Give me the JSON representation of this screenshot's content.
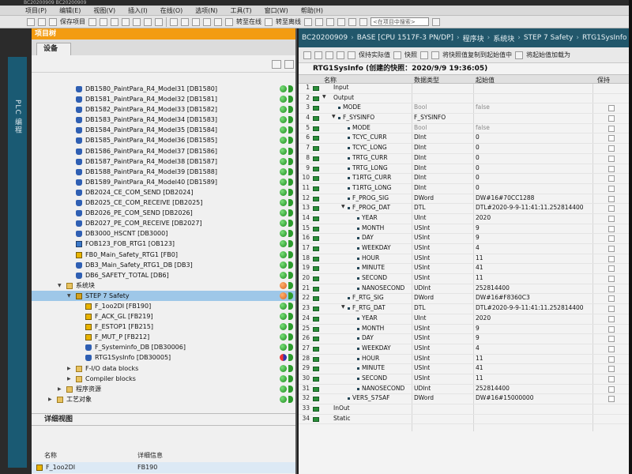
{
  "window": {
    "title": "BC20200909 BC20200909"
  },
  "menu": [
    "项目(P)",
    "编辑(E)",
    "视图(V)",
    "插入(I)",
    "在线(O)",
    "选项(N)",
    "工具(T)",
    "窗口(W)",
    "帮助(H)"
  ],
  "toolbar": {
    "save_project": "保存项目",
    "go_online": "转至在线",
    "go_offline": "转至离线",
    "search_placeholder": "<在项目中搜索>"
  },
  "vertical_tab": "PLC 编程",
  "project_tree": {
    "header": "项目树",
    "device_tab": "设备",
    "items": [
      {
        "label": "DB1580_PaintPara_R4_Model31 [DB1580]",
        "icon": "db-icon",
        "indent": 1,
        "status": "green"
      },
      {
        "label": "DB1581_PaintPara_R4_Model32 [DB1581]",
        "icon": "db-icon",
        "indent": 1,
        "status": "green"
      },
      {
        "label": "DB1582_PaintPara_R4_Model33 [DB1582]",
        "icon": "db-icon",
        "indent": 1,
        "status": "green"
      },
      {
        "label": "DB1583_PaintPara_R4_Model34 [DB1583]",
        "icon": "db-icon",
        "indent": 1,
        "status": "green"
      },
      {
        "label": "DB1584_PaintPara_R4_Model35 [DB1584]",
        "icon": "db-icon",
        "indent": 1,
        "status": "green"
      },
      {
        "label": "DB1585_PaintPara_R4_Model36 [DB1585]",
        "icon": "db-icon",
        "indent": 1,
        "status": "green"
      },
      {
        "label": "DB1586_PaintPara_R4_Model37 [DB1586]",
        "icon": "db-icon",
        "indent": 1,
        "status": "green"
      },
      {
        "label": "DB1587_PaintPara_R4_Model38 [DB1587]",
        "icon": "db-icon",
        "indent": 1,
        "status": "green"
      },
      {
        "label": "DB1588_PaintPara_R4_Model39 [DB1588]",
        "icon": "db-icon",
        "indent": 1,
        "status": "green"
      },
      {
        "label": "DB1589_PaintPara_R4_Model40 [DB1589]",
        "icon": "db-icon",
        "indent": 1,
        "status": "green"
      },
      {
        "label": "DB2024_CE_COM_SEND [DB2024]",
        "icon": "db-icon",
        "indent": 1,
        "status": "green"
      },
      {
        "label": "DB2025_CE_COM_RECEIVE [DB2025]",
        "icon": "db-icon",
        "indent": 1,
        "status": "green"
      },
      {
        "label": "DB2026_PE_COM_SEND [DB2026]",
        "icon": "db-icon",
        "indent": 1,
        "status": "green"
      },
      {
        "label": "DB2027_PE_COM_RECEIVE [DB2027]",
        "icon": "db-icon",
        "indent": 1,
        "status": "green"
      },
      {
        "label": "DB3000_HSCNT [DB3000]",
        "icon": "db-icon",
        "indent": 1,
        "status": "green"
      },
      {
        "label": "FOB123_FOB_RTG1 [OB123]",
        "icon": "ob-icon",
        "indent": 1,
        "status": "green"
      },
      {
        "label": "FB0_Main_Safety_RTG1 [FB0]",
        "icon": "fb-icon",
        "indent": 1,
        "status": "green"
      },
      {
        "label": "DB3_Main_Safety_RTG1_DB [DB3]",
        "icon": "db-icon",
        "indent": 1,
        "status": "green"
      },
      {
        "label": "DB6_SAFETY_TOTAL [DB6]",
        "icon": "db-icon",
        "indent": 1,
        "status": "green"
      },
      {
        "label": "系统块",
        "icon": "folder-icon",
        "indent": 0,
        "status": "orange",
        "expander": "▼"
      },
      {
        "label": "STEP 7 Safety",
        "icon": "safety-folder-icon",
        "indent": 1,
        "status": "orange",
        "expander": "▼",
        "selected": true
      },
      {
        "label": "F_1oo2DI [FB190]",
        "icon": "fb-icon",
        "indent": 2,
        "status": "green"
      },
      {
        "label": "F_ACK_GL [FB219]",
        "icon": "fb-icon",
        "indent": 2,
        "status": "green"
      },
      {
        "label": "F_ESTOP1 [FB215]",
        "icon": "fb-icon",
        "indent": 2,
        "status": "green"
      },
      {
        "label": "F_MUT_P [FB212]",
        "icon": "fb-icon",
        "indent": 2,
        "status": "green"
      },
      {
        "label": "F_Systeminfo_DB [DB30006]",
        "icon": "db-icon",
        "indent": 2,
        "status": "green"
      },
      {
        "label": "RTG1SysInfo [DB30005]",
        "icon": "db-icon",
        "indent": 2,
        "status": "split"
      },
      {
        "label": "F-I/O data blocks",
        "icon": "folder-icon",
        "indent": 1,
        "status": "green",
        "expander": "▶"
      },
      {
        "label": "Compiler blocks",
        "icon": "folder-icon",
        "indent": 1,
        "status": "green",
        "expander": "▶"
      },
      {
        "label": "程序资源",
        "icon": "folder-icon",
        "indent": 0,
        "status": "green",
        "expander": "▶"
      },
      {
        "label": "工艺对象",
        "icon": "folder-icon",
        "indent": -1,
        "status": "green",
        "expander": "▶"
      }
    ]
  },
  "detail_view": {
    "header": "详细视图",
    "col_name": "名称",
    "col_info": "详细信息",
    "row_name": "F_1oo2DI",
    "row_info": "FB190"
  },
  "editor": {
    "breadcrumb": [
      "BC20200909",
      "BASE [CPU 1517F-3 PN/DP]",
      "程序块",
      "系统块",
      "STEP 7 Safety",
      "RTG1SysInfo [DB30005]"
    ],
    "toolbar": {
      "keep_actual": "保持实际值",
      "snapshot": "快照",
      "copy_snapshot": "将快照值复制到起始值中",
      "load_start": "将起始值加载为"
    },
    "block_title": "RTG1SysInfo (创建的快照：2020/9/9 19:36:05)",
    "columns": {
      "name": "名称",
      "dtype": "数据类型",
      "start": "起始值",
      "retain": "保持"
    },
    "rows": [
      {
        "n": "1",
        "name": "Input",
        "level": 0,
        "arrow": "",
        "dtype": "",
        "start": ""
      },
      {
        "n": "2",
        "name": "Output",
        "level": 0,
        "arrow": "▼",
        "dtype": "",
        "start": ""
      },
      {
        "n": "3",
        "name": "MODE",
        "level": 1,
        "arrow": "",
        "dtype": "Bool",
        "start": "false",
        "muted": true
      },
      {
        "n": "4",
        "name": "F_SYSINFO",
        "level": 1,
        "arrow": "▼",
        "dtype": "F_SYSINFO",
        "start": ""
      },
      {
        "n": "5",
        "name": "MODE",
        "level": 2,
        "arrow": "",
        "dtype": "Bool",
        "start": "false",
        "muted": true
      },
      {
        "n": "6",
        "name": "TCYC_CURR",
        "level": 2,
        "arrow": "",
        "dtype": "DInt",
        "start": "0"
      },
      {
        "n": "7",
        "name": "TCYC_LONG",
        "level": 2,
        "arrow": "",
        "dtype": "DInt",
        "start": "0"
      },
      {
        "n": "8",
        "name": "TRTG_CURR",
        "level": 2,
        "arrow": "",
        "dtype": "DInt",
        "start": "0"
      },
      {
        "n": "9",
        "name": "TRTG_LONG",
        "level": 2,
        "arrow": "",
        "dtype": "DInt",
        "start": "0"
      },
      {
        "n": "10",
        "name": "T1RTG_CURR",
        "level": 2,
        "arrow": "",
        "dtype": "DInt",
        "start": "0"
      },
      {
        "n": "11",
        "name": "T1RTG_LONG",
        "level": 2,
        "arrow": "",
        "dtype": "DInt",
        "start": "0"
      },
      {
        "n": "12",
        "name": "F_PROG_SIG",
        "level": 2,
        "arrow": "",
        "dtype": "DWord",
        "start": "DW#16#70CC1288"
      },
      {
        "n": "13",
        "name": "F_PROG_DAT",
        "level": 2,
        "arrow": "▼",
        "dtype": "DTL",
        "start": "DTL#2020-9-9-11:41:11.252814400"
      },
      {
        "n": "14",
        "name": "YEAR",
        "level": 3,
        "arrow": "",
        "dtype": "UInt",
        "start": "2020"
      },
      {
        "n": "15",
        "name": "MONTH",
        "level": 3,
        "arrow": "",
        "dtype": "USInt",
        "start": "9"
      },
      {
        "n": "16",
        "name": "DAY",
        "level": 3,
        "arrow": "",
        "dtype": "USInt",
        "start": "9"
      },
      {
        "n": "17",
        "name": "WEEKDAY",
        "level": 3,
        "arrow": "",
        "dtype": "USInt",
        "start": "4"
      },
      {
        "n": "18",
        "name": "HOUR",
        "level": 3,
        "arrow": "",
        "dtype": "USInt",
        "start": "11"
      },
      {
        "n": "19",
        "name": "MINUTE",
        "level": 3,
        "arrow": "",
        "dtype": "USInt",
        "start": "41"
      },
      {
        "n": "20",
        "name": "SECOND",
        "level": 3,
        "arrow": "",
        "dtype": "USInt",
        "start": "11"
      },
      {
        "n": "21",
        "name": "NANOSECOND",
        "level": 3,
        "arrow": "",
        "dtype": "UDInt",
        "start": "252814400"
      },
      {
        "n": "22",
        "name": "F_RTG_SIG",
        "level": 2,
        "arrow": "",
        "dtype": "DWord",
        "start": "DW#16#F8360C3"
      },
      {
        "n": "23",
        "name": "F_RTG_DAT",
        "level": 2,
        "arrow": "▼",
        "dtype": "DTL",
        "start": "DTL#2020-9-9-11:41:11.252814400"
      },
      {
        "n": "24",
        "name": "YEAR",
        "level": 3,
        "arrow": "",
        "dtype": "UInt",
        "start": "2020"
      },
      {
        "n": "25",
        "name": "MONTH",
        "level": 3,
        "arrow": "",
        "dtype": "USInt",
        "start": "9"
      },
      {
        "n": "26",
        "name": "DAY",
        "level": 3,
        "arrow": "",
        "dtype": "USInt",
        "start": "9"
      },
      {
        "n": "27",
        "name": "WEEKDAY",
        "level": 3,
        "arrow": "",
        "dtype": "USInt",
        "start": "4"
      },
      {
        "n": "28",
        "name": "HOUR",
        "level": 3,
        "arrow": "",
        "dtype": "USInt",
        "start": "11"
      },
      {
        "n": "29",
        "name": "MINUTE",
        "level": 3,
        "arrow": "",
        "dtype": "USInt",
        "start": "41"
      },
      {
        "n": "30",
        "name": "SECOND",
        "level": 3,
        "arrow": "",
        "dtype": "USInt",
        "start": "11"
      },
      {
        "n": "31",
        "name": "NANOSECOND",
        "level": 3,
        "arrow": "",
        "dtype": "UDInt",
        "start": "252814400"
      },
      {
        "n": "32",
        "name": "VERS_S7SAF",
        "level": 2,
        "arrow": "",
        "dtype": "DWord",
        "start": "DW#16#15000000"
      },
      {
        "n": "33",
        "name": "InOut",
        "level": 0,
        "arrow": "",
        "dtype": "",
        "start": ""
      },
      {
        "n": "34",
        "name": "Static",
        "level": 0,
        "arrow": "",
        "dtype": "",
        "start": ""
      }
    ]
  }
}
